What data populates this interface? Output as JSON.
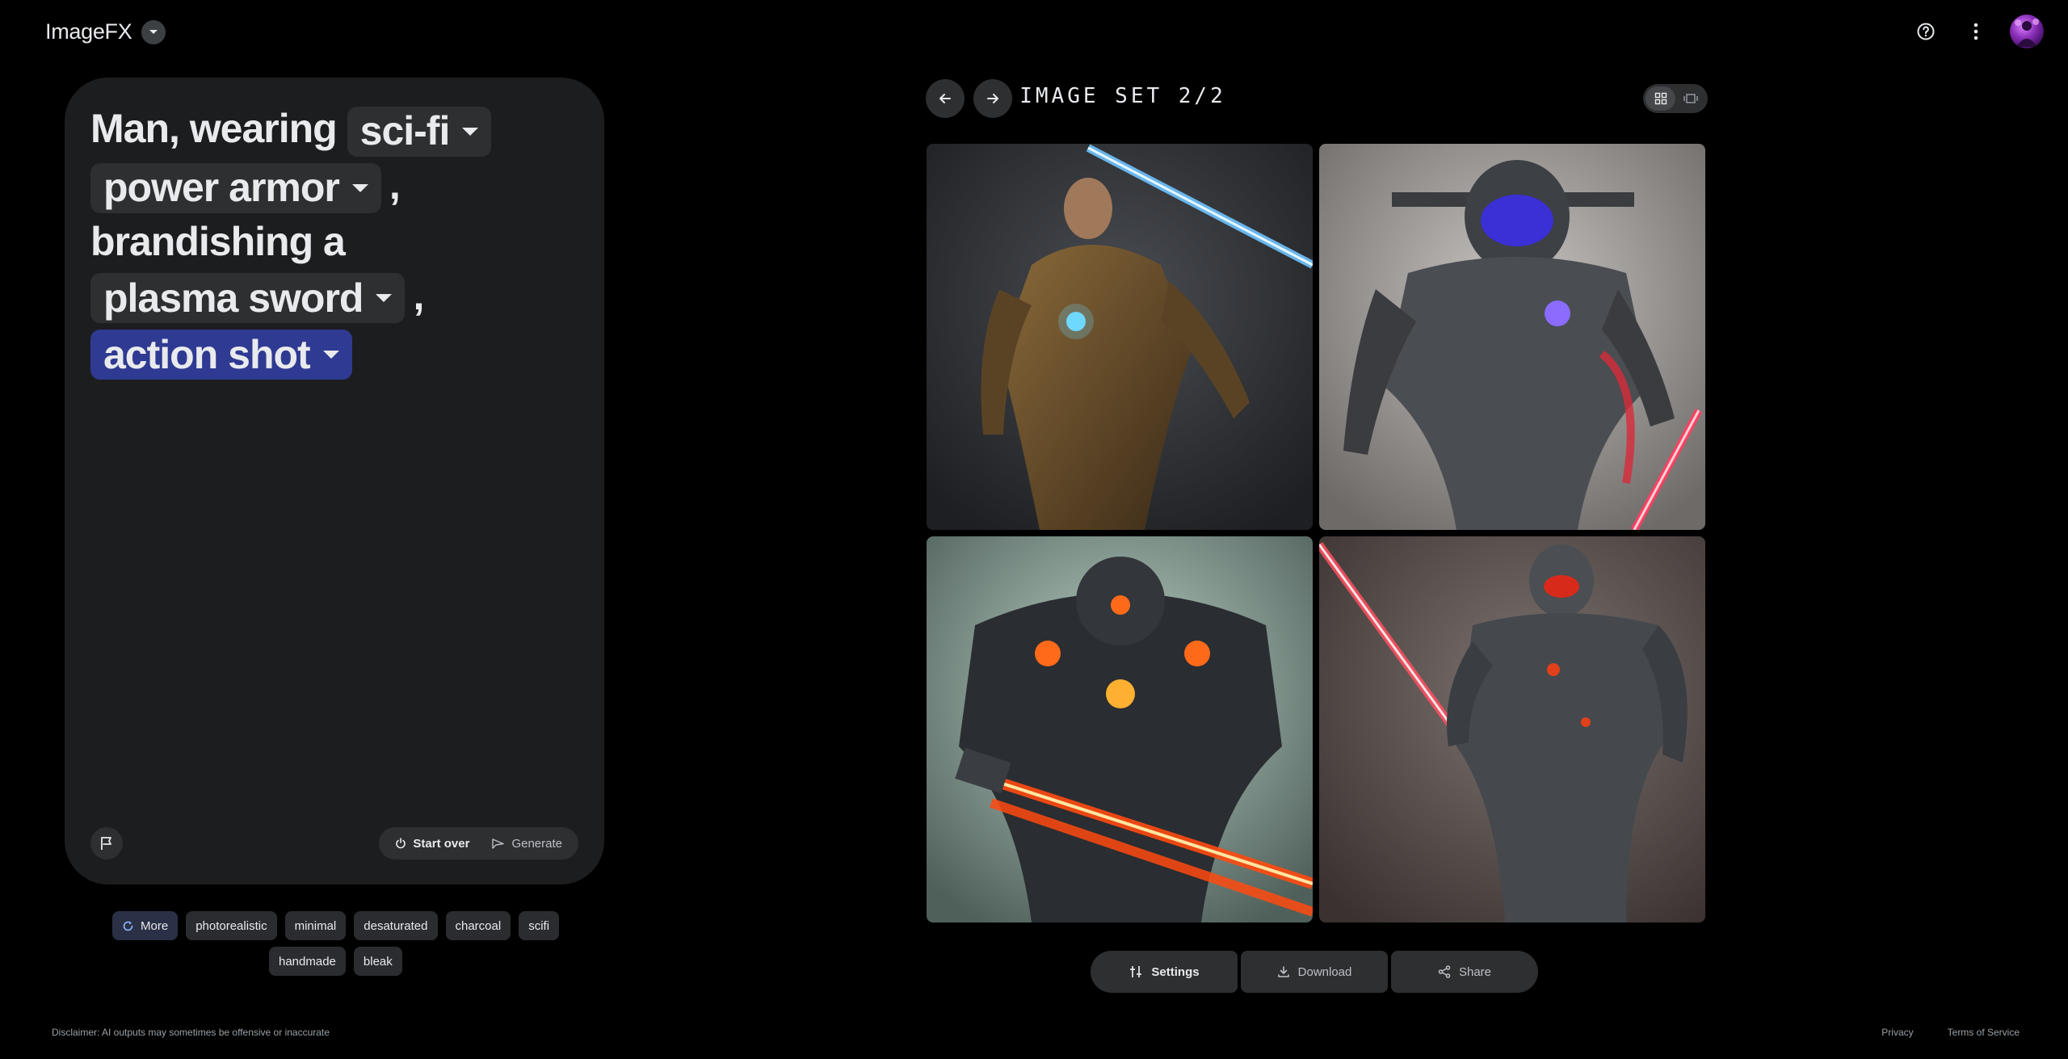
{
  "header": {
    "app_name": "ImageFX"
  },
  "prompt": {
    "segments": {
      "s1": "Man, wearing",
      "chip1": "sci-fi",
      "chip2": "power armor",
      "comma1": ",",
      "s2": "brandishing a",
      "chip3": "plasma sword",
      "comma2": ",",
      "chip4": "action shot"
    },
    "start_over_label": "Start over",
    "generate_label": "Generate"
  },
  "style_chips": {
    "more_label": "More",
    "row1": [
      "photorealistic",
      "minimal",
      "desaturated",
      "charcoal",
      "scifi"
    ],
    "row2": [
      "handmade",
      "bleak"
    ]
  },
  "viewer": {
    "title": "IMAGE SET 2/2"
  },
  "actions": {
    "settings": "Settings",
    "download": "Download",
    "share": "Share"
  },
  "footer": {
    "disclaimer": "Disclaimer: AI outputs may sometimes be offensive or inaccurate",
    "privacy": "Privacy",
    "terms": "Terms of Service"
  },
  "colors": {
    "background": "#000000",
    "card": "#1c1d1f",
    "chip": "#2d2f31",
    "active_chip": "#2f3a92",
    "more_chip": "#2a3046"
  }
}
